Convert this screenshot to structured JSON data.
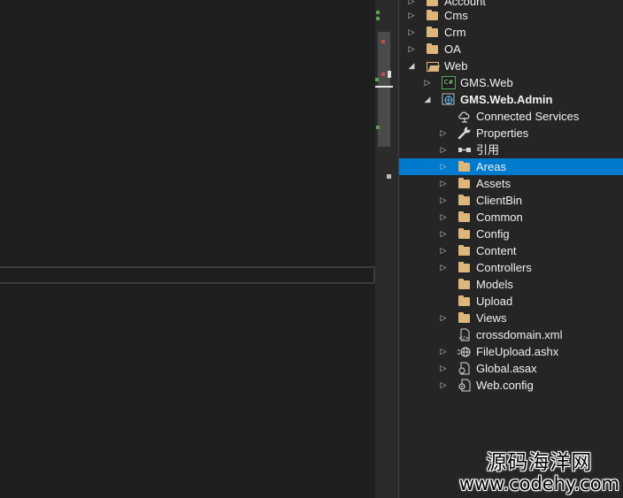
{
  "solution_explorer": {
    "items": [
      {
        "label": "Account",
        "icon": "folder-icon",
        "expander": "collapsed"
      },
      {
        "label": "Cms",
        "icon": "folder-icon",
        "expander": "collapsed"
      },
      {
        "label": "Crm",
        "icon": "folder-icon",
        "expander": "collapsed"
      },
      {
        "label": "OA",
        "icon": "folder-icon",
        "expander": "collapsed"
      },
      {
        "label": "Web",
        "icon": "folder-open-icon",
        "expander": "expanded"
      },
      {
        "label": "GMS.Web",
        "icon": "csharp-project-icon",
        "expander": "collapsed",
        "icon_text": "C#"
      },
      {
        "label": "GMS.Web.Admin",
        "icon": "web-project-icon",
        "expander": "expanded"
      },
      {
        "label": "Connected Services",
        "icon": "connected-services-icon",
        "expander": "none"
      },
      {
        "label": "Properties",
        "icon": "wrench-icon",
        "expander": "collapsed"
      },
      {
        "label": "引用",
        "icon": "references-icon",
        "expander": "collapsed"
      },
      {
        "label": "Areas",
        "icon": "folder-icon",
        "expander": "collapsed",
        "selected": true
      },
      {
        "label": "Assets",
        "icon": "folder-icon",
        "expander": "collapsed"
      },
      {
        "label": "ClientBin",
        "icon": "folder-icon",
        "expander": "collapsed"
      },
      {
        "label": "Common",
        "icon": "folder-icon",
        "expander": "collapsed"
      },
      {
        "label": "Config",
        "icon": "folder-icon",
        "expander": "collapsed"
      },
      {
        "label": "Content",
        "icon": "folder-icon",
        "expander": "collapsed"
      },
      {
        "label": "Controllers",
        "icon": "folder-icon",
        "expander": "collapsed"
      },
      {
        "label": "Models",
        "icon": "folder-icon",
        "expander": "none"
      },
      {
        "label": "Upload",
        "icon": "folder-icon",
        "expander": "none"
      },
      {
        "label": "Views",
        "icon": "folder-icon",
        "expander": "collapsed"
      },
      {
        "label": "crossdomain.xml",
        "icon": "xml-file-icon",
        "expander": "none"
      },
      {
        "label": "FileUpload.ashx",
        "icon": "ashx-file-icon",
        "expander": "collapsed"
      },
      {
        "label": "Global.asax",
        "icon": "asax-file-icon",
        "expander": "collapsed"
      },
      {
        "label": "Web.config",
        "icon": "config-file-icon",
        "expander": "collapsed"
      }
    ]
  },
  "colors": {
    "selection": "#007acc",
    "folder": "#dcb67a",
    "panel_bg": "#252526",
    "editor_bg": "#1e1e1e"
  },
  "watermark": {
    "line1": "源码海洋网",
    "line2": "www.codehy.com"
  }
}
